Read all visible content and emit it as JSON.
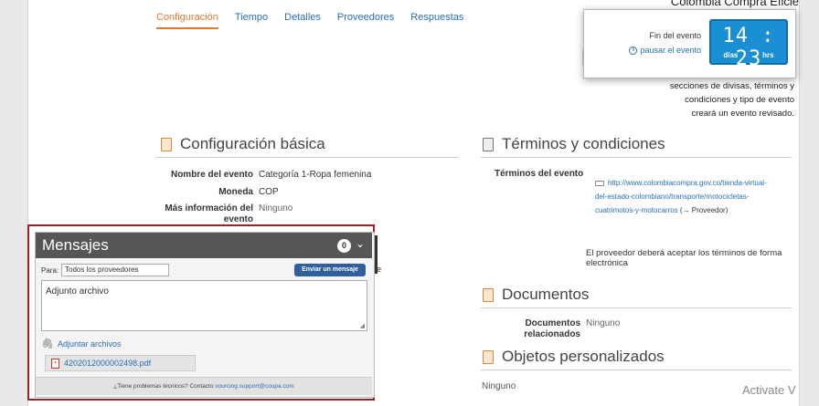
{
  "brand": "Colombia Compra Eficie",
  "tabs": [
    {
      "label": "Configuración",
      "active": true
    },
    {
      "label": "Tiempo"
    },
    {
      "label": "Detalles"
    },
    {
      "label": "Proveedores"
    },
    {
      "label": "Respuestas"
    }
  ],
  "header_button": "Fi",
  "timer": {
    "label": "Fin del evento",
    "pause": "pausar el evento",
    "days": "14",
    "hours": "23",
    "days_unit": "días",
    "hours_unit": "hrs"
  },
  "note": "secciones de divisas, términos y condiciones y tipo de evento creará un evento revisado.",
  "basic": {
    "title": "Configuración básica",
    "event_name_label": "Nombre del evento",
    "event_name": "Categoría 1-Ropa femenina",
    "currency_label": "Moneda",
    "currency": "COP",
    "more_info_label": "Más información del evento",
    "more_info": "Ninguno"
  },
  "terms": {
    "title": "Términos y condiciones",
    "event_terms_label": "Términos del evento",
    "link": "http://www.colombiacompra.gov.co/tienda-virtual-del-estado-colombiano/transporte/motocicletas-cuatrimotos-y-motocarros",
    "provider_tag": "(→ Proveedor)",
    "accept": "El proveedor deberá aceptar los términos de forma electrónica"
  },
  "documents": {
    "title": "Documentos",
    "related_label": "Documentos relacionados",
    "related": "Ninguno"
  },
  "custom_objects": {
    "title": "Objetos personalizados",
    "value": "Ninguno"
  },
  "messages": {
    "title": "Mensajes",
    "count": "0",
    "to_label": "Para:",
    "to_value": "Todos los proveedores",
    "send_button": "Enviar un mensaje",
    "body": "Adjunto archivo",
    "attach_label": "Adjuntar archivos",
    "file_name": "4202012000002498.pdf",
    "help_text": "¿Tiene problemas técnicos? Contacto",
    "help_email": "sourcing.support@coupa.com"
  },
  "watermark": "Activate V",
  "stray": "e"
}
